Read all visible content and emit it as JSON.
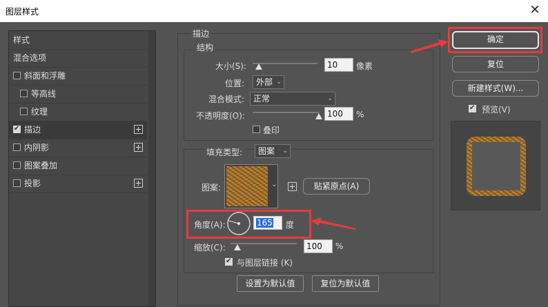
{
  "window": {
    "title": "图层样式"
  },
  "sidebar": {
    "items": [
      {
        "label": "样式"
      },
      {
        "label": "混合选项"
      },
      {
        "label": "斜面和浮雕",
        "checked": false
      },
      {
        "label": "等高线",
        "checked": false
      },
      {
        "label": "纹理",
        "checked": false
      },
      {
        "label": "描边",
        "checked": true,
        "selected": true
      },
      {
        "label": "内阴影",
        "checked": false
      },
      {
        "label": "图案叠加",
        "checked": false
      },
      {
        "label": "投影",
        "checked": false
      }
    ]
  },
  "stroke": {
    "section_title": "描边",
    "structure_title": "结构",
    "size": {
      "label": "大小(S):",
      "value": "10",
      "unit": "像素",
      "level": 0.1
    },
    "position": {
      "label": "位置:",
      "value": "外部"
    },
    "blend_mode": {
      "label": "混合模式:",
      "value": "正常"
    },
    "opacity": {
      "label": "不透明度(O):",
      "value": "100",
      "unit": "%",
      "level": 1.0
    },
    "overprint": {
      "label": "叠印",
      "checked": false
    },
    "fill_type": {
      "label": "填充类型:",
      "value": "图案"
    },
    "pattern": {
      "label": "图案:",
      "snap_button": "贴紧原点(A)"
    },
    "angle": {
      "label": "角度(A):",
      "value": "165",
      "unit": "度"
    },
    "scale": {
      "label": "缩放(C):",
      "value": "100",
      "unit": "%",
      "level": 0.1
    },
    "link": {
      "label": "与图层链接 (K)",
      "checked": true
    },
    "default_buttons": {
      "set": "设置为默认值",
      "reset": "复位为默认值"
    }
  },
  "actions": {
    "ok": "确定",
    "reset": "复位",
    "new_style": "新建样式(W)...",
    "preview": "预览(V)",
    "preview_checked": true
  },
  "colors": {
    "panel": "#535353",
    "annotation_red": "#e43d3d",
    "pattern": "#a8772f"
  }
}
